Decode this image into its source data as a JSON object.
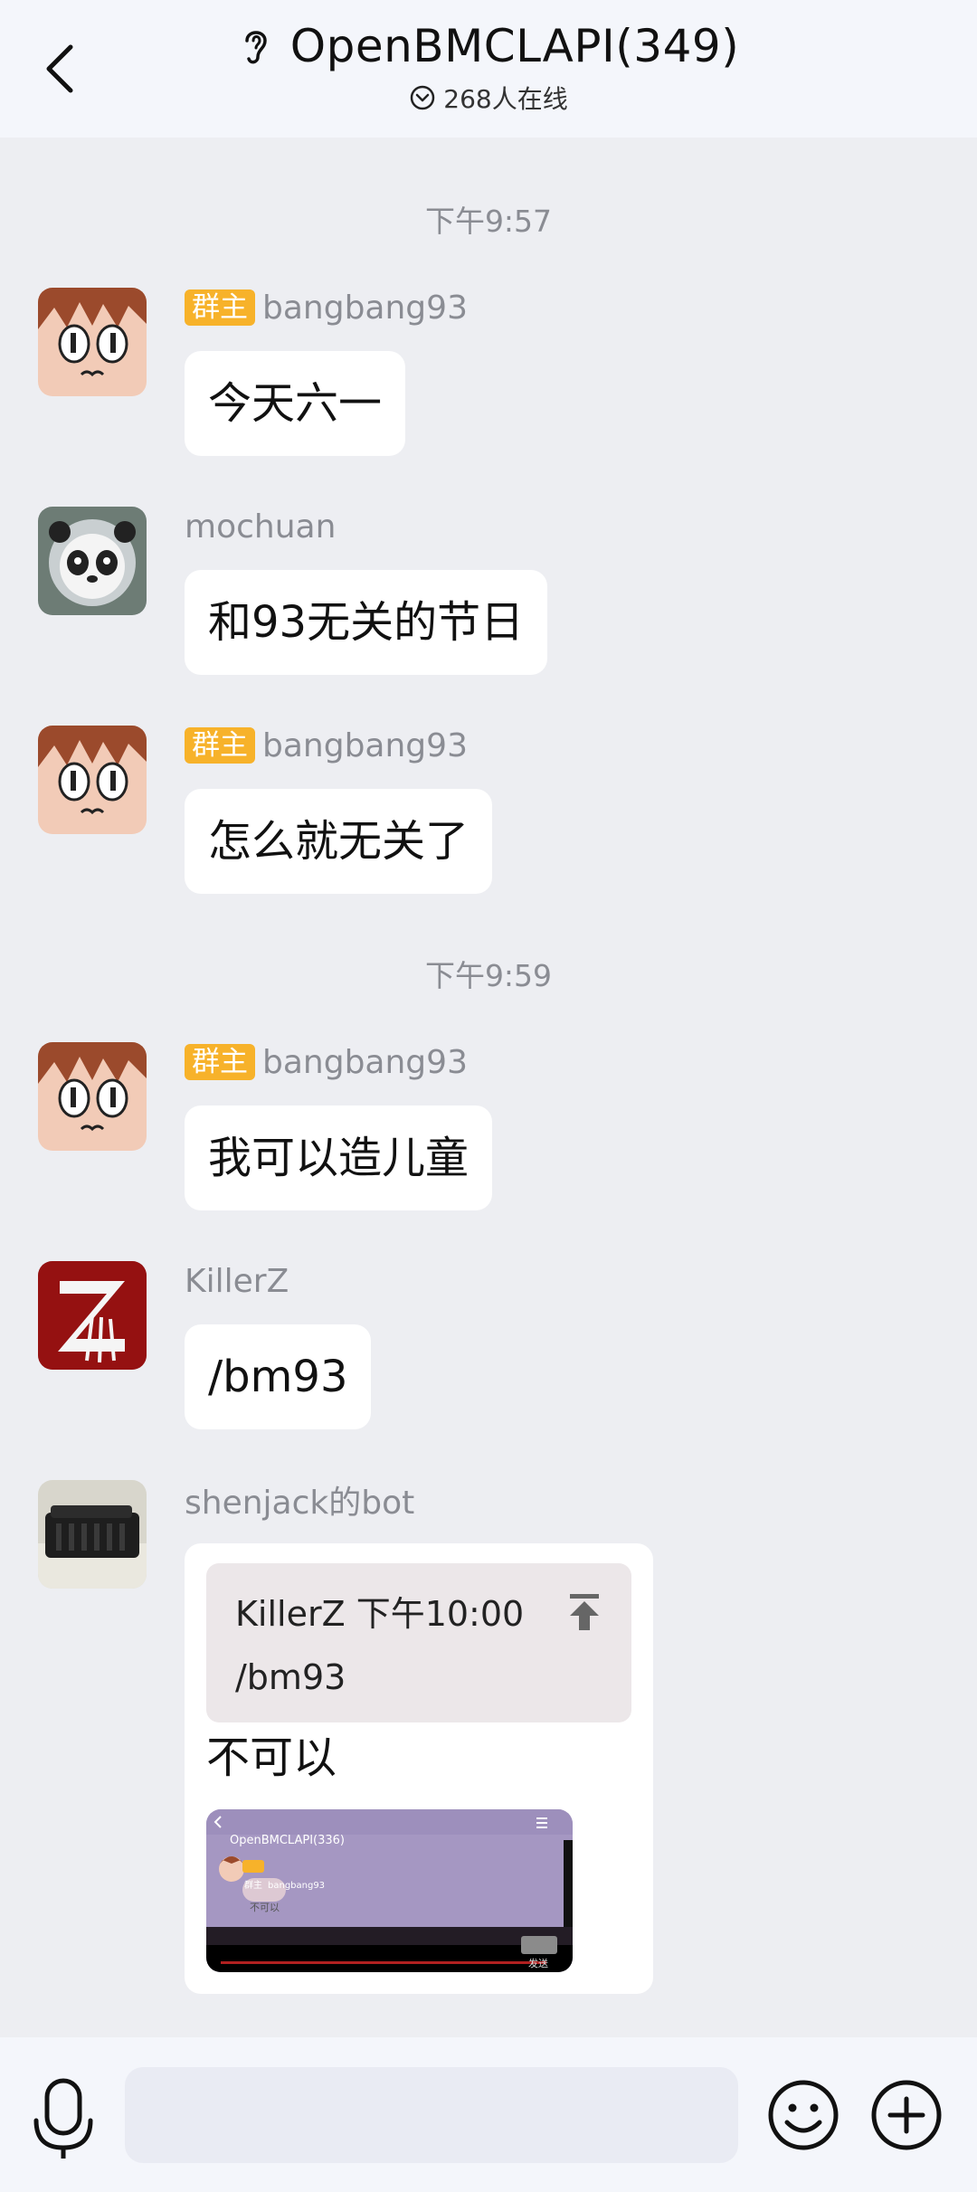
{
  "header": {
    "title": "OpenBMCLAPI(349)",
    "online": "268人在线",
    "back_icon": "chevron-left-icon",
    "title_icon": "ear-icon",
    "online_icon": "chevron-down-circle-icon"
  },
  "chat": {
    "time_1": "下午9:57",
    "time_2": "下午9:59",
    "messages": [
      {
        "sender": "bangbang93",
        "badge": "群主",
        "text": "今天六一"
      },
      {
        "sender": "mochuan",
        "badge": "",
        "text": "和93无关的节日"
      },
      {
        "sender": "bangbang93",
        "badge": "群主",
        "text": "怎么就无关了"
      },
      {
        "sender": "bangbang93",
        "badge": "群主",
        "text": "我可以造儿童"
      },
      {
        "sender": "KillerZ",
        "badge": "",
        "text": "/bm93"
      },
      {
        "sender": "shenjack的bot",
        "badge": "",
        "quote_header": "KillerZ 下午10:00",
        "quote_text": "/bm93",
        "text": "不可以",
        "thumbnail": {
          "title": "OpenBMCLAPI(336)",
          "badge": "群主",
          "sender": "bangbang93",
          "bubble": "不可以",
          "send": "发送"
        }
      }
    ]
  },
  "input_bar": {
    "placeholder": "",
    "mic_icon": "microphone-icon",
    "emoji_icon": "smiley-icon",
    "plus_icon": "plus-circle-icon"
  },
  "colors": {
    "badge": "#f7b22a",
    "bubble": "#ffffff",
    "background": "#edeef2",
    "quote": "#ece7e9"
  }
}
